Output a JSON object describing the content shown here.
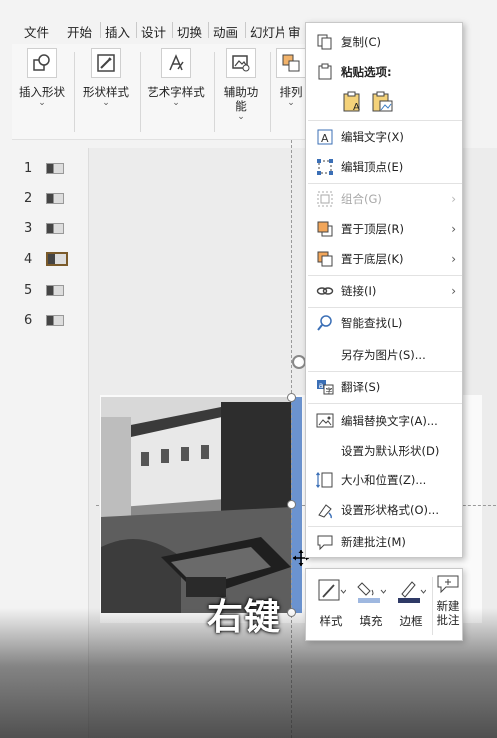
{
  "ribbon": {
    "tabs": [
      "文件",
      "开始",
      "插入",
      "设计",
      "切换",
      "动画",
      "幻灯片",
      "审"
    ],
    "groups": [
      {
        "label": "插入形状",
        "icon": "insert-shape-icon"
      },
      {
        "label": "形状样式",
        "icon": "shape-style-icon"
      },
      {
        "label": "艺术字样式",
        "icon": "wordart-style-icon"
      },
      {
        "label": "辅助功能",
        "label_line1": "辅助功",
        "label_line2": "能",
        "icon": "accessibility-icon"
      },
      {
        "label": "排列",
        "label_line1": "排列",
        "icon": "arrange-icon"
      }
    ]
  },
  "thumbnails": {
    "items": [
      "1",
      "2",
      "3",
      "4",
      "5",
      "6"
    ],
    "active_index": 4
  },
  "caption": "右键",
  "context_menu": {
    "copy": "复制(C)",
    "paste_options": "粘贴选项:",
    "edit_text": "编辑文字(X)",
    "edit_points": "编辑顶点(E)",
    "group": "组合(G)",
    "bring_to_front": "置于顶层(R)",
    "send_to_back": "置于底层(K)",
    "link": "链接(I)",
    "smart_lookup": "智能查找(L)",
    "save_as_picture": "另存为图片(S)...",
    "translate": "翻译(S)",
    "edit_alt_text": "编辑替换文字(A)...",
    "set_default_shape": "设置为默认形状(D)",
    "size_position": "大小和位置(Z)...",
    "format_shape": "设置形状格式(O)...",
    "new_comment": "新建批注(M)"
  },
  "mini_toolbar": {
    "style": "样式",
    "fill": "填充",
    "outline": "边框",
    "new_comment_line1": "新建",
    "new_comment_line2": "批注"
  },
  "colors": {
    "selection_bar": "#6b93cf",
    "fill_swatch": "#9fb8e0",
    "outline_swatch": "#2f3a66"
  }
}
